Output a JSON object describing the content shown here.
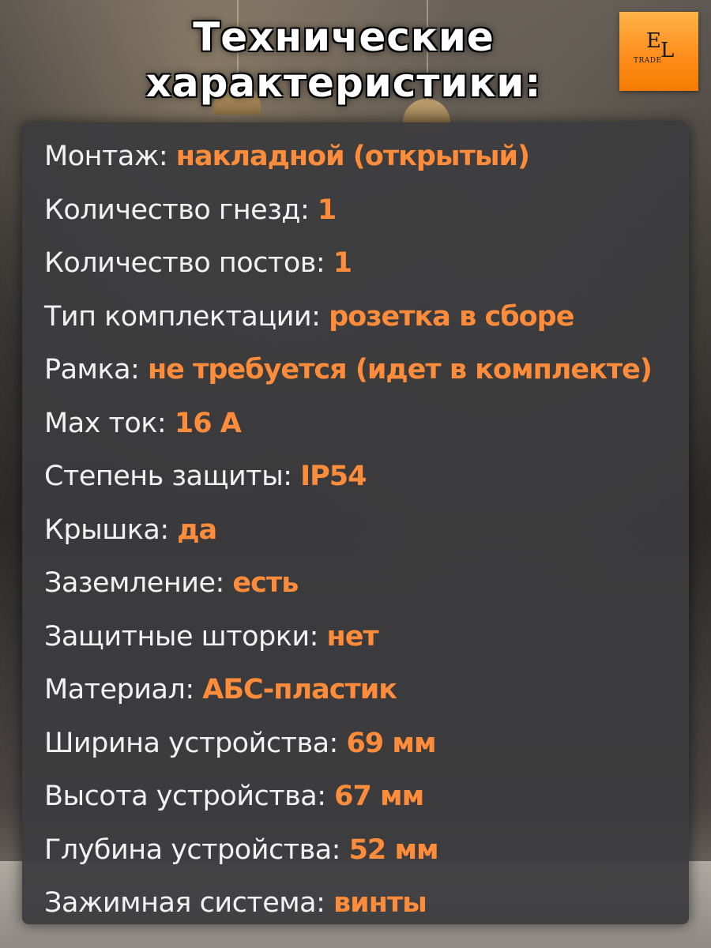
{
  "title": {
    "line1": "Технические",
    "line2": "характеристики:"
  },
  "logo": {
    "letter_e": "E",
    "letter_l": "L",
    "trade": "TRADE"
  },
  "colors": {
    "accent": "#ff8c3a",
    "label": "#f2f2f2",
    "panel": "#3c3c3e",
    "logo": "#ff9a2e"
  },
  "specs": [
    {
      "label": "Монтаж: ",
      "value": "накладной (открытый)"
    },
    {
      "label": "Количество гнезд: ",
      "value": "1"
    },
    {
      "label": "Количество постов: ",
      "value": "1"
    },
    {
      "label": "Тип комплектации: ",
      "value": "розетка в сборе"
    },
    {
      "label": "Рамка: ",
      "value": "не требуется (идет в комплекте)"
    },
    {
      "label": "Max ток: ",
      "value": "16 А"
    },
    {
      "label": "Степень защиты: ",
      "value": "IP54"
    },
    {
      "label": "Крышка: ",
      "value": "да"
    },
    {
      "label": "Заземление: ",
      "value": "есть"
    },
    {
      "label": "Защитные шторки: ",
      "value": "нет"
    },
    {
      "label": "Материал: ",
      "value": "АБС-пластик"
    },
    {
      "label": "Ширина устройства: ",
      "value": "69 мм"
    },
    {
      "label": "Высота устройства: ",
      "value": "67 мм"
    },
    {
      "label": "Глубина устройства: ",
      "value": "52 мм"
    },
    {
      "label": "Зажимная система: ",
      "value": "винты"
    }
  ]
}
